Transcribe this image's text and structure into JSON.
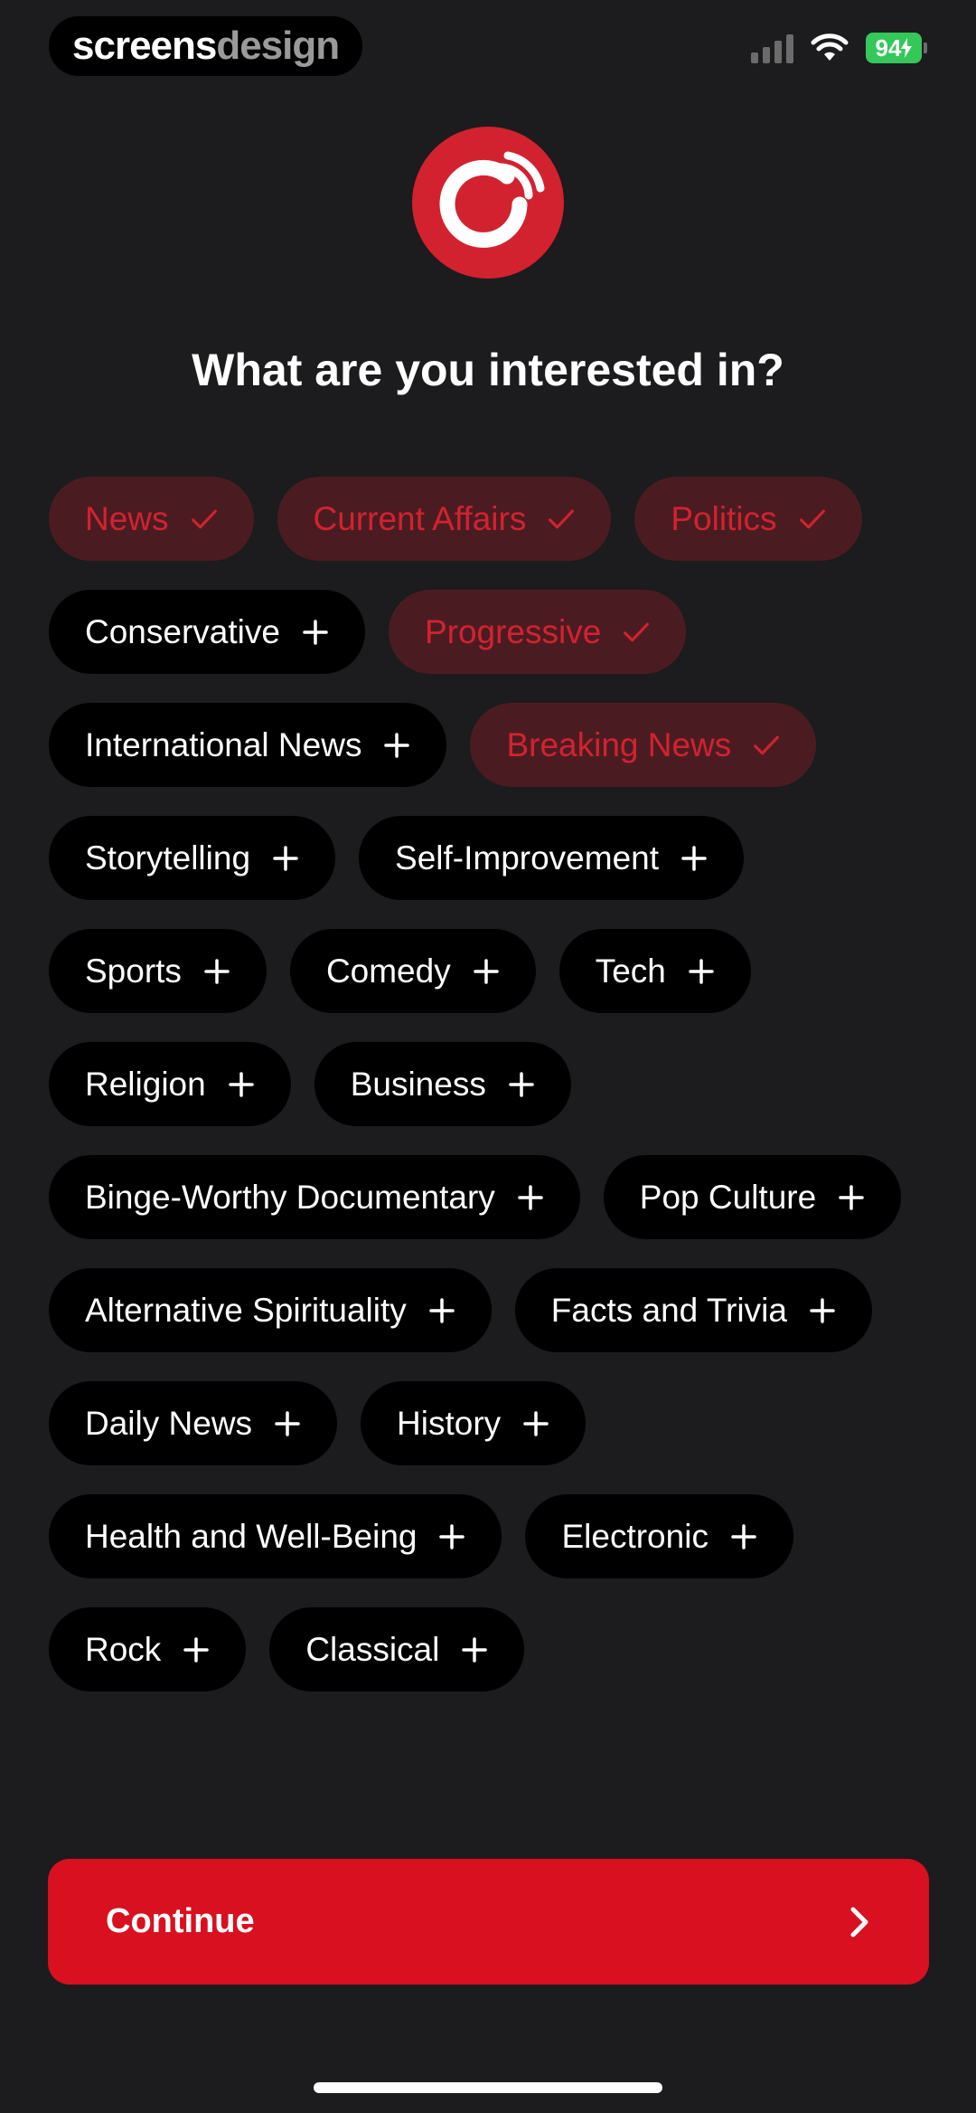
{
  "status_bar": {
    "brand_part1": "screens",
    "brand_part2": "design",
    "battery": "94",
    "icons": [
      "cellular-signal-icon",
      "wifi-icon",
      "battery-charging-icon"
    ]
  },
  "logo": {
    "icon": "podcast-app-logo-icon"
  },
  "heading": "What are you interested in?",
  "colors": {
    "background": "#1c1b1d",
    "chip_bg": "#000000",
    "chip_selected_bg": "#4a1c22",
    "accent": "#d3222f",
    "button": "#d8101f"
  },
  "topics": [
    {
      "label": "News",
      "selected": true
    },
    {
      "label": "Current Affairs",
      "selected": true
    },
    {
      "label": "Politics",
      "selected": true
    },
    {
      "label": "Conservative",
      "selected": false
    },
    {
      "label": "Progressive",
      "selected": true
    },
    {
      "label": "International News",
      "selected": false
    },
    {
      "label": "Breaking News",
      "selected": true
    },
    {
      "label": "Storytelling",
      "selected": false
    },
    {
      "label": "Self-Improvement",
      "selected": false
    },
    {
      "label": "Sports",
      "selected": false
    },
    {
      "label": "Comedy",
      "selected": false
    },
    {
      "label": "Tech",
      "selected": false
    },
    {
      "label": "Religion",
      "selected": false
    },
    {
      "label": "Business",
      "selected": false
    },
    {
      "label": "Binge-Worthy Documentary",
      "selected": false
    },
    {
      "label": "Pop Culture",
      "selected": false
    },
    {
      "label": "Alternative Spirituality",
      "selected": false
    },
    {
      "label": "Facts and Trivia",
      "selected": false
    },
    {
      "label": "Daily News",
      "selected": false
    },
    {
      "label": "History",
      "selected": false
    },
    {
      "label": "Health and Well-Being",
      "selected": false
    },
    {
      "label": "Electronic",
      "selected": false
    },
    {
      "label": "Rock",
      "selected": false
    },
    {
      "label": "Classical",
      "selected": false
    }
  ],
  "continue_button": {
    "label": "Continue",
    "icon": "chevron-right-icon"
  }
}
